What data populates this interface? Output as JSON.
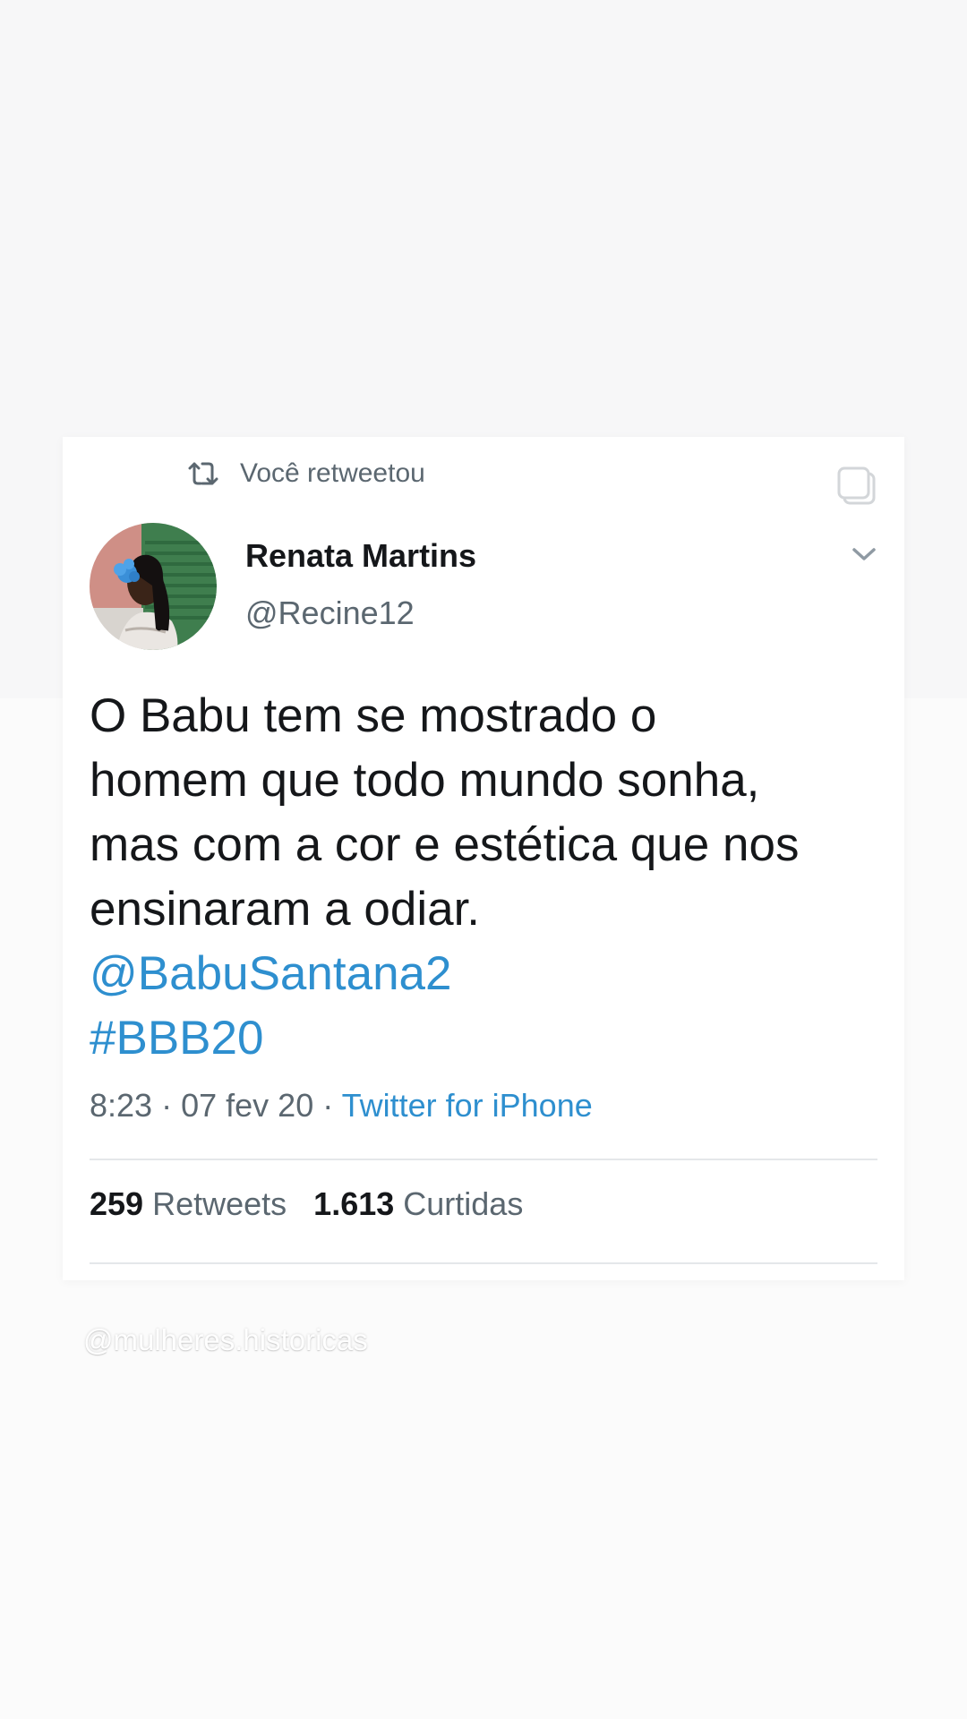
{
  "retweet": {
    "icon": "retweet-icon",
    "label": "Você retweetou"
  },
  "author": {
    "name": "Renata Martins",
    "handle": "@Recine12",
    "avatar": "avatar-photo"
  },
  "tweet": {
    "text_lines": [
      "O Babu tem se mostrado o",
      "homem que todo mundo sonha,",
      "mas com a cor e estética que nos",
      "ensinaram a odiar."
    ],
    "mention": "@BabuSantana2",
    "hashtag": "#BBB20"
  },
  "meta": {
    "time": "8:23",
    "separator": "·",
    "date": "07 fev 20",
    "source": "Twitter for iPhone"
  },
  "stats": {
    "retweets_count": "259",
    "retweets_label": "Retweets",
    "likes_count": "1.613",
    "likes_label": "Curtidas"
  },
  "watermark": "@mulheres.historicas",
  "colors": {
    "link": "#2e8fcf",
    "text": "#15171a",
    "secondary": "#5b6770"
  }
}
